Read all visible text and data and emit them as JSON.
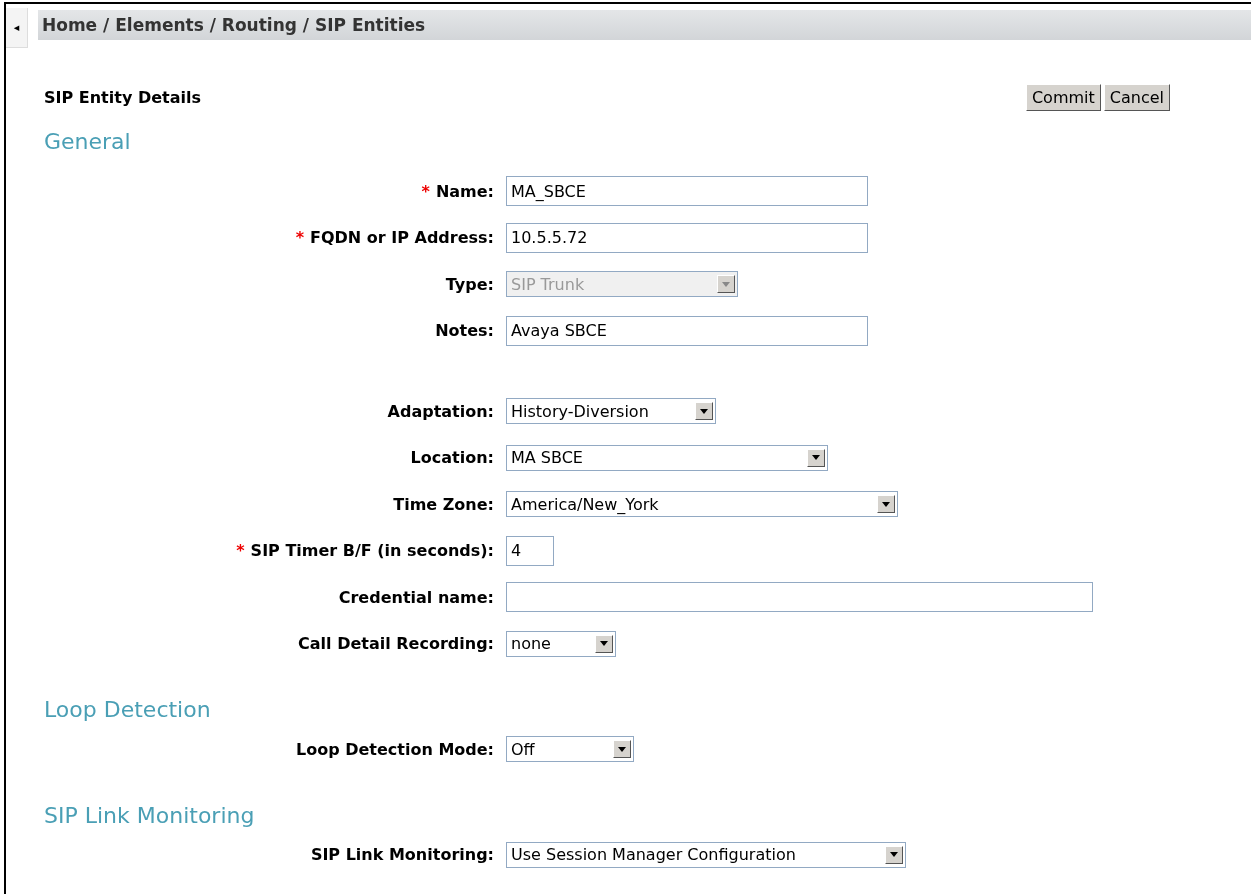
{
  "collapse_toggle": "◂",
  "breadcrumb": "Home / Elements / Routing / SIP Entities",
  "page_title": "SIP Entity Details",
  "buttons": [
    {
      "label": "Commit"
    },
    {
      "label": "Cancel"
    }
  ],
  "sections": [
    {
      "title": "General",
      "groups": [
        [
          {
            "label": "Name:",
            "kind": "text",
            "value": "MA_SBCE",
            "required": true,
            "disabled": false
          },
          {
            "label": "FQDN or IP Address:",
            "kind": "text",
            "value": "10.5.5.72",
            "required": true,
            "disabled": false
          },
          {
            "label": "Type:",
            "kind": "select",
            "value": "SIP Trunk",
            "required": false,
            "disabled": true
          },
          {
            "label": "Notes:",
            "kind": "text",
            "value": "Avaya SBCE",
            "required": false,
            "disabled": false
          }
        ],
        [
          {
            "label": "Adaptation:",
            "kind": "select",
            "value": "History-Diversion",
            "required": false,
            "disabled": false
          },
          {
            "label": "Location:",
            "kind": "select",
            "value": "MA SBCE",
            "required": false,
            "disabled": false
          },
          {
            "label": "Time Zone:",
            "kind": "select",
            "value": "America/New_York",
            "required": false,
            "disabled": false
          },
          {
            "label": "SIP Timer B/F (in seconds):",
            "kind": "text",
            "value": "4",
            "required": true,
            "disabled": false
          },
          {
            "label": "Credential name:",
            "kind": "text",
            "required": false,
            "disabled": false
          },
          {
            "label": "Call Detail Recording:",
            "kind": "select",
            "value": "none",
            "required": false,
            "disabled": false
          }
        ]
      ]
    },
    {
      "title": "Loop Detection",
      "groups": [
        [
          {
            "label": "Loop Detection Mode:",
            "kind": "select",
            "value": "Off",
            "required": false,
            "disabled": false
          }
        ]
      ]
    },
    {
      "title": "SIP Link Monitoring",
      "groups": [
        [
          {
            "label": "SIP Link Monitoring:",
            "kind": "select",
            "value": "Use Session Manager Configuration",
            "required": false,
            "disabled": false
          }
        ]
      ]
    }
  ],
  "required_mark": "*"
}
